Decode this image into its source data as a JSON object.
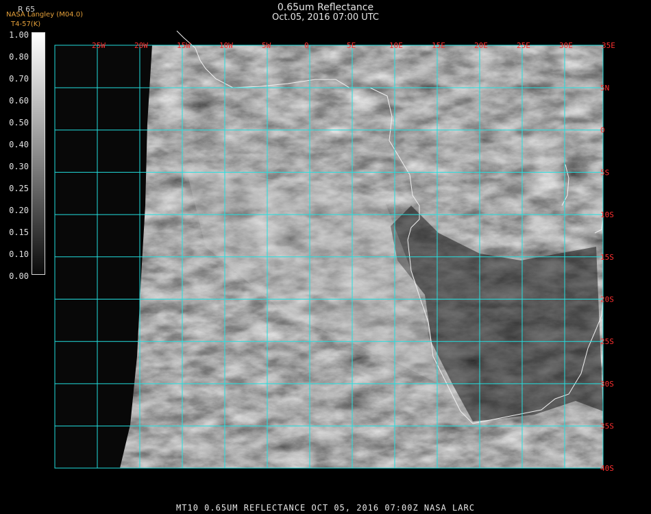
{
  "header": {
    "title": "0.65um Reflectance",
    "datetime": "Oct.05, 2016 07:00 UTC"
  },
  "source": {
    "producer": "NASA Langley (M04.0)",
    "product": "T4-57(K)",
    "colorbar_top_label": "R 65"
  },
  "colorbar": {
    "labels": [
      "1.00",
      "0.80",
      "0.70",
      "0.60",
      "0.50",
      "0.40",
      "0.30",
      "0.25",
      "0.20",
      "0.15",
      "0.10",
      "0.00"
    ],
    "colors": {
      "top": "#ffffff",
      "bottom": "#0a0a0a"
    }
  },
  "map": {
    "longitude_labels": [
      "25W",
      "20W",
      "15W",
      "10W",
      "5W",
      "0",
      "5E",
      "10E",
      "15E",
      "20E",
      "25E",
      "30E",
      "35E"
    ],
    "latitude_labels": [
      "5N",
      "0",
      "5S",
      "10S",
      "15S",
      "20S",
      "25S",
      "30S",
      "35S",
      "40S"
    ],
    "colors": {
      "grid": "#22e0e0",
      "labels": "#ff3030",
      "coast": "#f0f0f0"
    }
  },
  "footer": {
    "text": "MT10   0.65UM REFLECTANCE    OCT 05, 2016 07:00Z    NASA LARC"
  }
}
